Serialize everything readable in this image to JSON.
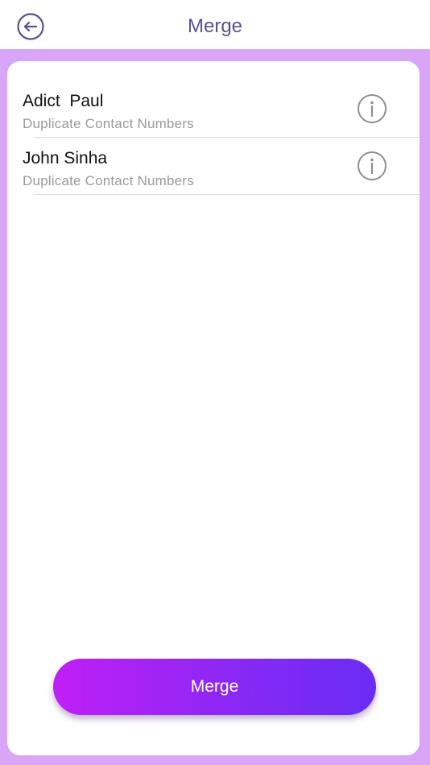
{
  "header": {
    "title": "Merge",
    "back_icon": "arrow-left-circle-icon",
    "accent_color": "#5b4f91"
  },
  "colors": {
    "background": "#d9a5f6",
    "card": "#ffffff",
    "button_gradient_start": "#c01ff5",
    "button_gradient_end": "#6a2cf5"
  },
  "contacts": [
    {
      "name": "Adict  Paul",
      "subtitle": "Duplicate Contact Numbers",
      "icon": "info-circle-icon"
    },
    {
      "name": "John Sinha",
      "subtitle": "Duplicate Contact Numbers",
      "icon": "info-circle-icon"
    }
  ],
  "footer": {
    "merge_label": "Merge"
  }
}
